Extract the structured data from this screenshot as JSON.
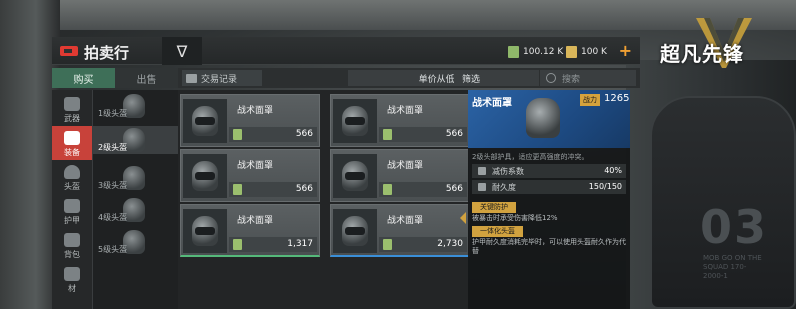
{
  "header": {
    "title": "拍卖行",
    "menu_glyph": "∇",
    "currency1": "100.12 K",
    "currency2": "100 K",
    "add_glyph": "+"
  },
  "logo_text": "超凡先锋",
  "tabs": [
    {
      "label": "购买",
      "active": true
    },
    {
      "label": "出售",
      "active": false
    }
  ],
  "categories": [
    {
      "label": "武器",
      "active": false
    },
    {
      "label": "装备",
      "active": true
    },
    {
      "label": "头盔",
      "active": false
    },
    {
      "label": "护甲",
      "active": false
    },
    {
      "label": "背包",
      "active": false
    },
    {
      "label": "材",
      "active": false
    }
  ],
  "subcategories": [
    {
      "label": "1级头盔",
      "active": false
    },
    {
      "label": "2级头盔",
      "active": true
    },
    {
      "label": "3级头盔",
      "active": false
    },
    {
      "label": "4级头盔",
      "active": false
    },
    {
      "label": "5级头盔",
      "active": false
    }
  ],
  "toolbar": {
    "record_label": "交易记录",
    "sort_label": "单价从低到高 ▾",
    "filter_label": "筛选",
    "search_placeholder": "搜索"
  },
  "listings": [
    {
      "name": "战术面罩",
      "price": "566",
      "border": "none"
    },
    {
      "name": "战术面罩",
      "price": "566",
      "border": "none"
    },
    {
      "name": "战术面罩",
      "price": "566",
      "border": "none"
    },
    {
      "name": "战术面罩",
      "price": "566",
      "border": "none"
    },
    {
      "name": "战术面罩",
      "price": "1,317",
      "border": "green"
    },
    {
      "name": "战术面罩",
      "price": "2,730",
      "border": "blue"
    }
  ],
  "detail": {
    "name": "战术面罩",
    "power_label": "战力",
    "power_value": "1265",
    "description": "2级头部护具，适应更高强度的冲突。",
    "stats": [
      {
        "label": "减伤系数",
        "value": "40%"
      },
      {
        "label": "耐久度",
        "value": "150/150"
      }
    ],
    "tag1": "关键防护",
    "tag1_text": "被暴击时承受伤害降低12%",
    "tag2": "一体化头盔",
    "tag2_text": "护甲耐久度消耗完毕时，可以使用头盔耐久作为代替"
  },
  "vest_number": "03",
  "vest_text": "MOB GO ON THE SQUAD 170-2000-1"
}
